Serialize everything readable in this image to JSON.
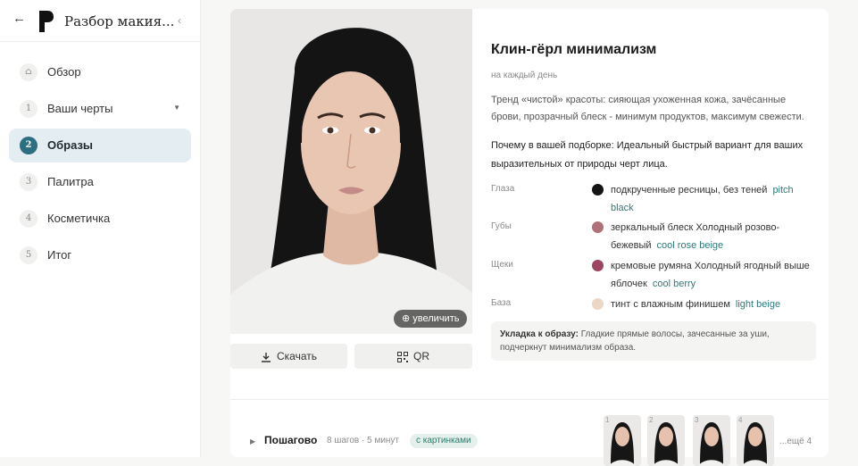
{
  "app": {
    "title": "Разбор макия..."
  },
  "nav": [
    {
      "num": "⌂",
      "label": "Обзор"
    },
    {
      "num": "1",
      "label": "Ваши черты"
    },
    {
      "num": "2",
      "label": "Образы"
    },
    {
      "num": "3",
      "label": "Палитра"
    },
    {
      "num": "4",
      "label": "Косметичка"
    },
    {
      "num": "5",
      "label": "Итог"
    }
  ],
  "look": {
    "title": "Клин-гёрл минимализм",
    "subtitle": "на каждый день",
    "description": "Тренд «чистой» красоты: сияющая ухоженная кожа, зачёсанные брови, прозрачный блеск - минимум продуктов, максимум свежести.",
    "why": "Почему в вашей подборке: Идеальный быстрый вариант для ваших выразительных от природы черт лица.",
    "zoom_label": "увеличить",
    "download_label": "Скачать",
    "qr_label": "QR",
    "features": [
      {
        "label": "Глаза",
        "text": "подкрученные ресницы, без теней",
        "tag": "pitch black",
        "color": "#141414"
      },
      {
        "label": "Губы",
        "text": "зеркальный блеск Холодный розово-бежевый",
        "tag": "cool rose beige",
        "color": "#b07078"
      },
      {
        "label": "Щеки",
        "text": "кремовые румяна Холодный ягодный выше яблочек",
        "tag": "cool berry",
        "color": "#9c4560"
      },
      {
        "label": "База",
        "text": "тинт с влажным финишем",
        "tag": "light beige",
        "color": "#ecd6c6"
      }
    ],
    "styling_label": "Укладка к образу:",
    "styling_text": "Гладкие прямые волосы, зачесанные за уши, подчеркнут минимализм образа."
  },
  "steps": {
    "title": "Пошагово",
    "meta": "8 шагов · 5 минут",
    "badge": "с картинками",
    "thumbs": [
      "1",
      "2",
      "3",
      "4"
    ],
    "more": "...ещё 4"
  }
}
